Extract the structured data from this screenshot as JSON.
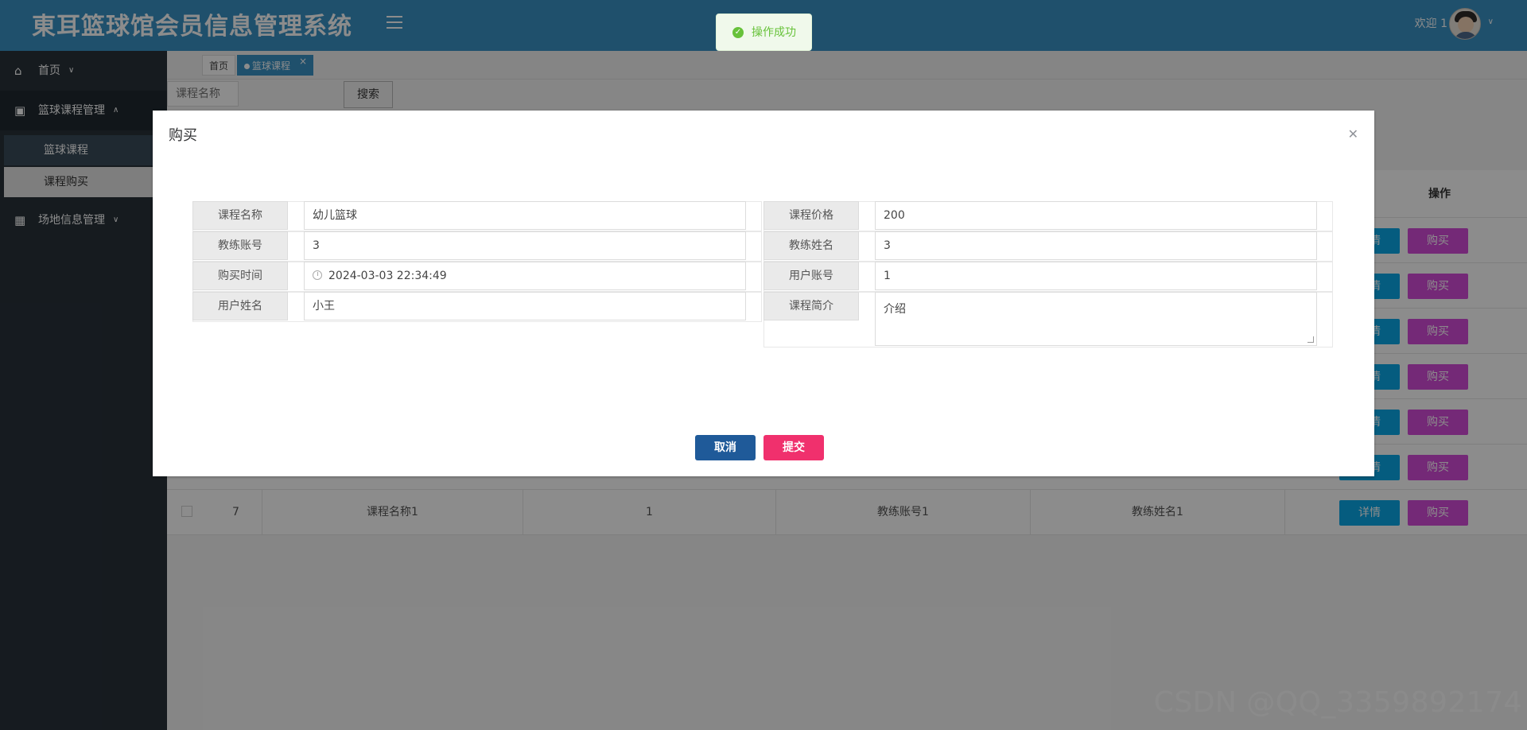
{
  "header": {
    "title": "東耳篮球馆会员信息管理系统",
    "welcome": "欢迎 1",
    "menu_icon": "hamburger-icon",
    "avatar_icon": "user-avatar-icon"
  },
  "toast": {
    "message": "操作成功",
    "icon": "check-circle-icon",
    "color": "#67c23a"
  },
  "sidebar": {
    "items": [
      {
        "label": "首页",
        "icon": "home-icon",
        "caret": "chevron-down-icon"
      },
      {
        "label": "篮球课程管理",
        "icon": "chart-icon",
        "caret": "chevron-up-icon",
        "children": [
          {
            "label": "篮球课程"
          },
          {
            "label": "课程购买"
          }
        ]
      },
      {
        "label": "场地信息管理",
        "icon": "grid-icon",
        "caret": "chevron-down-icon"
      }
    ]
  },
  "tabs": [
    {
      "label": "首页"
    },
    {
      "label": "篮球课程",
      "active": true
    }
  ],
  "search": {
    "placeholder": "课程名称",
    "button": "搜索"
  },
  "table": {
    "header_ops": "操作",
    "detail_label": "详情",
    "buy_label": "购买",
    "last_row": {
      "index": "7",
      "course_name": "课程名称1",
      "price": "1",
      "coach_account": "教练账号1",
      "coach_name": "教练姓名1"
    }
  },
  "dialog": {
    "title": "购买",
    "close_icon": "close-icon",
    "fields": {
      "course_name": {
        "label": "课程名称",
        "value": "幼儿篮球"
      },
      "course_price": {
        "label": "课程价格",
        "value": "200"
      },
      "coach_account": {
        "label": "教练账号",
        "value": "3"
      },
      "coach_name": {
        "label": "教练姓名",
        "value": "3"
      },
      "purchase_time": {
        "label": "购买时间",
        "value": "2024-03-03 22:34:49"
      },
      "user_account": {
        "label": "用户账号",
        "value": "1"
      },
      "user_name": {
        "label": "用户姓名",
        "value": "小王"
      },
      "course_intro": {
        "label": "课程简介",
        "value": "介绍"
      }
    },
    "cancel_label": "取消",
    "submit_label": "提交"
  },
  "watermark": "CSDN @QQ_3359892174",
  "colors": {
    "header": "#3a93c5",
    "sidebar": "#28323a",
    "detail_button": "#0aa8e8",
    "buy_button": "#d44bd9",
    "cancel_button": "#1f5a99",
    "submit_button": "#f0306d"
  }
}
